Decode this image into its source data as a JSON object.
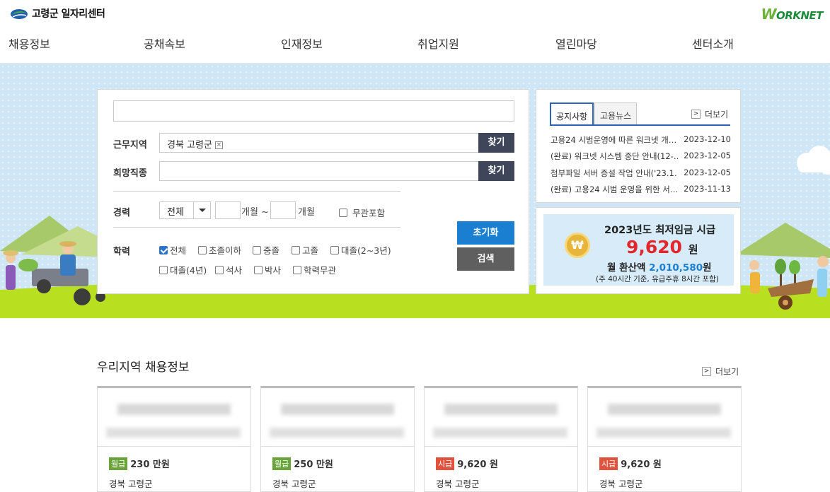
{
  "header": {
    "logo_text": "고령군 일자리센터",
    "worknet_logo": "WORKNET"
  },
  "nav": {
    "items": [
      "채용정보",
      "공채속보",
      "인재정보",
      "취업지원",
      "열린마당",
      "센터소개"
    ]
  },
  "search": {
    "keyword_value": "",
    "region_label": "근무지역",
    "region_value": "경북 고령군",
    "job_label": "희망직종",
    "job_value": "",
    "find_label": "찾기",
    "career_label": "경력",
    "career_select": "전체",
    "month_unit_1": "개월 ~",
    "month_unit_2": "개월",
    "career_any_label": "무관포함",
    "edu_label": "학력",
    "edu_options": [
      {
        "label": "전체",
        "checked": true
      },
      {
        "label": "초졸이하",
        "checked": false
      },
      {
        "label": "중졸",
        "checked": false
      },
      {
        "label": "고졸",
        "checked": false
      },
      {
        "label": "대졸(2~3년)",
        "checked": false
      },
      {
        "label": "대졸(4년)",
        "checked": false
      },
      {
        "label": "석사",
        "checked": false
      },
      {
        "label": "박사",
        "checked": false
      },
      {
        "label": "학력무관",
        "checked": false
      }
    ],
    "reset_label": "초기화",
    "search_label": "검색"
  },
  "notice": {
    "tabs": [
      "공지사항",
      "고용뉴스"
    ],
    "more_label": "더보기",
    "items": [
      {
        "title": "고용24 시범운영에 따른 워크넷 개…",
        "date": "2023-12-10"
      },
      {
        "title": "(완료) 워크넷 시스템 중단 안내(12-…",
        "date": "2023-12-05"
      },
      {
        "title": "첨부파일 서버 증설 작업 안내('23.1…",
        "date": "2023-12-05"
      },
      {
        "title": "(완료) 고용24 시범 운영을 위한 서…",
        "date": "2023-11-13"
      }
    ]
  },
  "banner": {
    "line1": "2023년도 최저임금 시급",
    "amount": "9,620",
    "won": "원",
    "line3_prefix": "월 환산액",
    "line3_amount": "2,010,580",
    "line3_suffix": "원",
    "line4": "(주 40시간 기준, 유급주휴 8시간 포함)",
    "coin_symbol": "₩"
  },
  "jobs": {
    "title": "우리지역 채용정보",
    "more_label": "더보기",
    "cards": [
      {
        "wage_type": "월급",
        "wage": "230 만원",
        "location": "경북 고령군"
      },
      {
        "wage_type": "월급",
        "wage": "250 만원",
        "location": "경북 고령군"
      },
      {
        "wage_type": "시급",
        "wage": "9,620 원",
        "location": "경북 고령군"
      },
      {
        "wage_type": "시급",
        "wage": "9,620 원",
        "location": "경북 고령군"
      }
    ]
  },
  "colors": {
    "primary_blue": "#1b7fd1",
    "dark_button": "#3f4659",
    "grass_green": "#b8e021",
    "sky": "#cfe6f6"
  }
}
